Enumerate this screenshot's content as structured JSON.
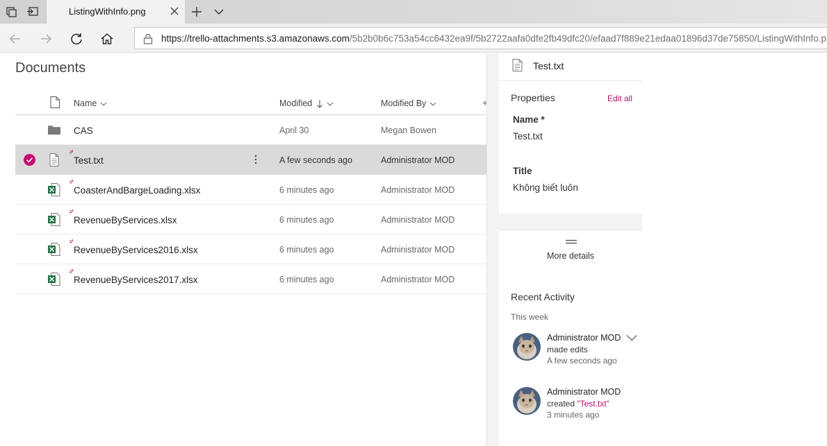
{
  "browser": {
    "tab_title": "ListingWithInfo.png",
    "url_host": "https://trello-attachments.s3.amazonaws.com",
    "url_path": "/5b2b0b6c753a54cc6432ea9f/5b2722aafa0dfe2fb49dfc20/efaad7f889e21edaa01896d37de75850/ListingWithInfo.png"
  },
  "library": {
    "title": "Documents",
    "columns": {
      "name": "Name",
      "modified": "Modified",
      "modified_by": "Modified By",
      "add": "+"
    },
    "rows": [
      {
        "name": "CAS",
        "modified": "April 30",
        "modified_by": "Megan Bowen",
        "icon": "folder-icon"
      },
      {
        "name": "Test.txt",
        "modified": "A few seconds ago",
        "modified_by": "Administrator MOD",
        "icon": "text-file-icon"
      },
      {
        "name": "CoasterAndBargeLoading.xlsx",
        "modified": "6 minutes ago",
        "modified_by": "Administrator MOD",
        "icon": "excel-file-icon"
      },
      {
        "name": "RevenueByServices.xlsx",
        "modified": "6 minutes ago",
        "modified_by": "Administrator MOD",
        "icon": "excel-file-icon"
      },
      {
        "name": "RevenueByServices2016.xlsx",
        "modified": "6 minutes ago",
        "modified_by": "Administrator MOD",
        "icon": "excel-file-icon"
      },
      {
        "name": "RevenueByServices2017.xlsx",
        "modified": "6 minutes ago",
        "modified_by": "Administrator MOD",
        "icon": "excel-file-icon"
      }
    ]
  },
  "details": {
    "file_name": "Test.txt",
    "properties_title": "Properties",
    "edit_all": "Edit all",
    "name_label": "Name *",
    "name_value": "Test.txt",
    "title_label": "Title",
    "title_value": "Không biết luôn",
    "more_details": "More details",
    "recent_activity_title": "Recent Activity",
    "this_week": "This week",
    "activities": [
      {
        "user": "Administrator MOD",
        "verb": "made edits",
        "time": "A few seconds ago"
      },
      {
        "user": "Administrator MOD",
        "verb": "created ",
        "link": "\"Test.txt\"",
        "time": "3 minutes ago"
      }
    ]
  },
  "colors": {
    "accent": "#c30d72",
    "link": "#b4106c",
    "excel": "#217346",
    "selected_row": "#dadada"
  }
}
